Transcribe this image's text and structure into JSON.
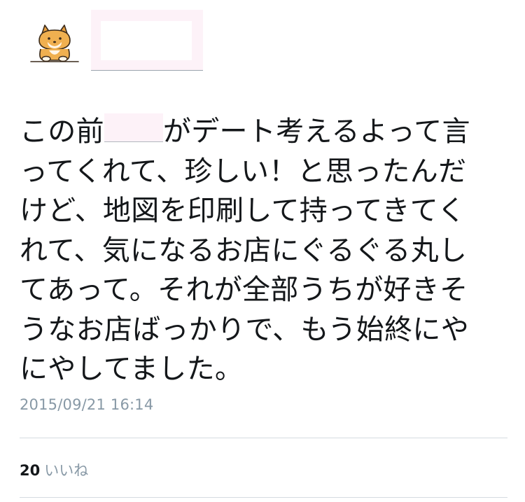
{
  "tweet": {
    "lines": [
      "この前",
      "がデート考えるよって言",
      "ってくれて、珍しい！と思ったんだ",
      "けど、地図を印刷して持ってきてく",
      "れて、気になるお店にぐるぐる丸し",
      "てあって。それが全部うちが好きそ",
      "うなお店ばっかりで、もう始終にや",
      "にやしてました。"
    ],
    "timestamp": "2015/09/21 16:14"
  },
  "stats": {
    "like_count": "20",
    "like_label": "いいね"
  },
  "icons": {
    "avatar": "shiba-dog-icon"
  },
  "colors": {
    "text": "#14171a",
    "muted": "#8899a6",
    "divider": "#d5dbe0",
    "redaction": "#fdf2f8"
  }
}
